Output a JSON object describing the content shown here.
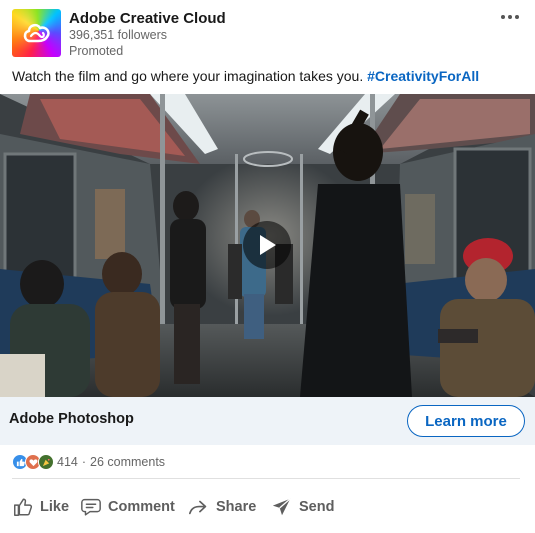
{
  "post": {
    "author": "Adobe Creative Cloud",
    "followers": "396,351 followers",
    "promoted": "Promoted",
    "caption_text": "Watch the film and go where your imagination takes you. ",
    "hashtag": "#CreativityForAll"
  },
  "ad": {
    "title": "Adobe Photoshop",
    "cta_label": "Learn more"
  },
  "social_counts": {
    "reactions": "414",
    "separator": "·",
    "comments": "26 comments",
    "reaction_icons": [
      "like-icon",
      "love-icon",
      "celebrate-icon"
    ]
  },
  "actions": {
    "like": "Like",
    "comment": "Comment",
    "share": "Share",
    "send": "Send"
  },
  "colors": {
    "link_blue": "#0a66c2",
    "cta_bar_bg": "#eef3f8",
    "muted_text": "#666666"
  }
}
